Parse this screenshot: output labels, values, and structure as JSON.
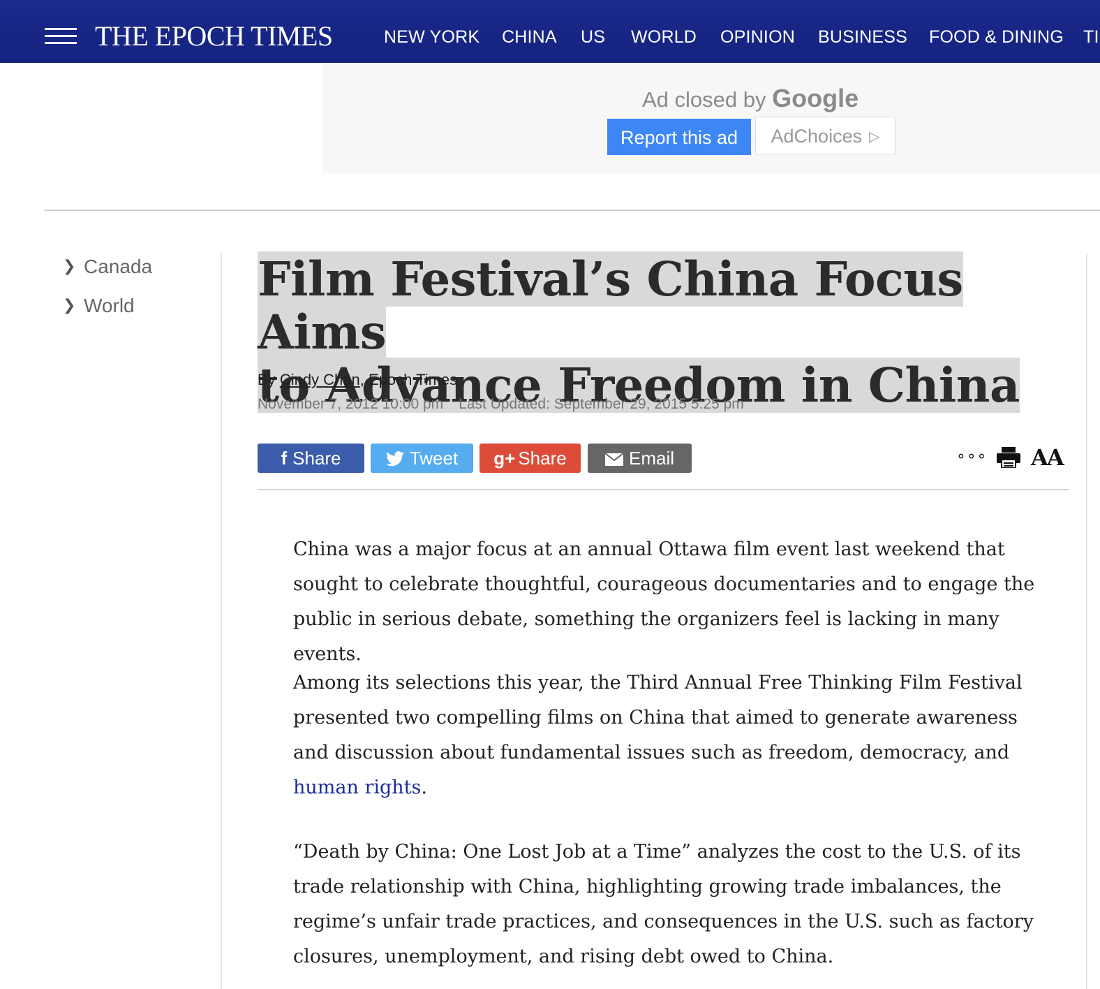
{
  "header": {
    "logo": "THE EPOCH TIMES",
    "nav": [
      "NEW YORK",
      "CHINA",
      "US",
      "WORLD",
      "OPINION",
      "BUSINESS",
      "FOOD & DINING",
      "TI"
    ]
  },
  "ad": {
    "closed_text": "Ad closed by",
    "closed_brand": "Google",
    "report_label": "Report this ad",
    "adchoices_label": "AdChoices",
    "adchoices_icon": "▷"
  },
  "sidebar": {
    "items": [
      {
        "label": "Canada"
      },
      {
        "label": "World"
      }
    ]
  },
  "article": {
    "title_line1": "Film Festival’s China Focus Aims",
    "title_line2": "to Advance Freedom in China",
    "by_prefix": "By",
    "author": "Cindy Chan",
    "publication": ", Epoch Times",
    "published": "November 7, 2012 10:00 pm",
    "last_updated": "Last Updated: September 29, 2015 5:25 pm",
    "share": {
      "facebook": "Share",
      "twitter": "Tweet",
      "gplus": "Share",
      "email": "Email",
      "gplus_icon": "g+"
    },
    "tools": {
      "more": "∘∘∘",
      "font_size": "AA"
    },
    "paragraphs": {
      "p1": "China was a major focus at an annual Ottawa film event last weekend that sought to celebrate thoughtful, courageous documentaries and to engage the public in serious debate, something the organizers feel is lacking in many events.",
      "p2_text": "Among its selections this year, the Third Annual Free Thinking Film Festival presented two compelling films on China that aimed to generate awareness and discussion about fundamental issues such as freedom, democracy, and ",
      "p2_link": "human rights",
      "p2_end": ".",
      "p3": "“Death by China: One Lost Job at a Time” analyzes the cost to the U.S. of its trade relationship with China, highlighting growing trade imbalances, the regime’s unfair trade practices, and consequences in the U.S. such as factory closures, unemployment, and rising debt owed to China."
    }
  },
  "colors": {
    "header_bg": "#1b2a8c",
    "facebook": "#3b5bab",
    "twitter": "#55acee",
    "gplus": "#dd4b39",
    "email": "#666666",
    "report_ad": "#3d86f5",
    "link": "#1b2a9e",
    "headline_highlight": "#d9d9d9"
  }
}
